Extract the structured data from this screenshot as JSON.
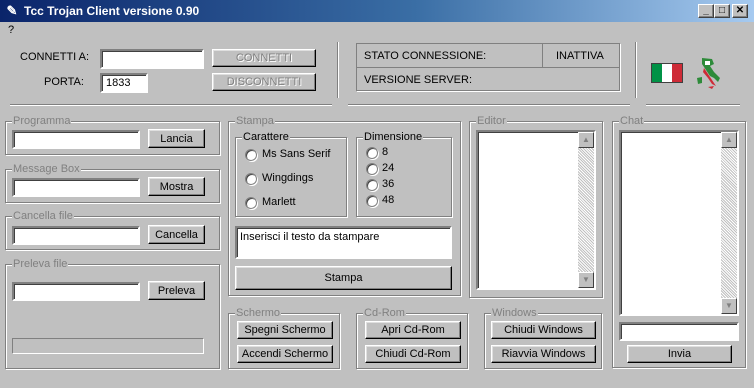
{
  "window": {
    "title": "Tcc Trojan Client versione 0.90",
    "controls": [
      "_",
      "□",
      "✕"
    ]
  },
  "menu": {
    "help": "?"
  },
  "connection": {
    "host_label": "CONNETTI A:",
    "host_value": "",
    "port_label": "PORTA:",
    "port_value": "1833",
    "connect_button": "CONNETTI",
    "disconnect_button": "DISCONNETTI"
  },
  "status": {
    "connection_label": "STATO CONNESSIONE:",
    "connection_value": "INATTIVA",
    "server_version_label": "VERSIONE SERVER:",
    "server_version_value": ""
  },
  "flags": {
    "italy": [
      "#009246",
      "#ffffff",
      "#ce2b37"
    ]
  },
  "programma": {
    "legend": "Programma",
    "value": "",
    "button": "Lancia"
  },
  "message_box": {
    "legend": "Message Box",
    "value": "",
    "button": "Mostra"
  },
  "cancella_file": {
    "legend": "Cancella file",
    "value": "",
    "button": "Cancella"
  },
  "preleva_file": {
    "legend": "Preleva file",
    "value": "",
    "button": "Preleva",
    "progress": 0
  },
  "stampa": {
    "legend": "Stampa",
    "carattere_legend": "Carattere",
    "fonts": [
      "Ms Sans Serif",
      "Wingdings",
      "Marlett"
    ],
    "dimensione_legend": "Dimensione",
    "sizes": [
      "8",
      "24",
      "36",
      "48"
    ],
    "text_value": "Inserisci il testo da stampare",
    "button": "Stampa"
  },
  "editor": {
    "legend": "Editor"
  },
  "chat": {
    "legend": "Chat",
    "input_value": "",
    "button": "Invia"
  },
  "schermo": {
    "legend": "Schermo",
    "off_button": "Spegni Schermo",
    "on_button": "Accendi Schermo"
  },
  "cdrom": {
    "legend": "Cd-Rom",
    "open_button": "Apri Cd-Rom",
    "close_button": "Chiudi Cd-Rom"
  },
  "windows": {
    "legend": "Windows",
    "close_button": "Chiudi Windows",
    "restart_button": "Riavvia Windows"
  }
}
